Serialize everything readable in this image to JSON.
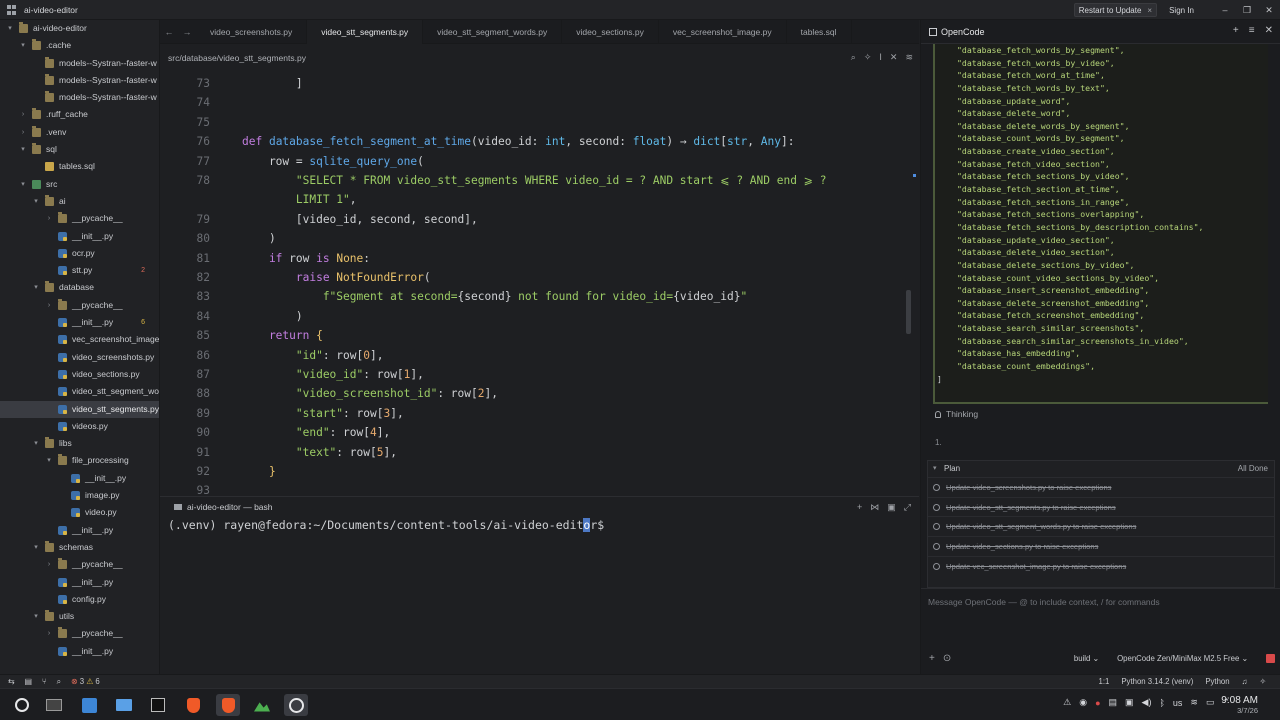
{
  "window": {
    "title": "ai-video-editor",
    "restart_label": "Restart to Update",
    "signin_label": "Sign In"
  },
  "sidebar": {
    "items": [
      {
        "label": "ai-video-editor",
        "depth": 0,
        "kind": "folder-open",
        "arrow": "▾"
      },
      {
        "label": ".cache",
        "depth": 1,
        "kind": "folder",
        "arrow": "▾"
      },
      {
        "label": "models--Systran--faster-w",
        "depth": 2,
        "kind": "folder",
        "arrow": ""
      },
      {
        "label": "models--Systran--faster-w",
        "depth": 2,
        "kind": "folder",
        "arrow": ""
      },
      {
        "label": "models--Systran--faster-w",
        "depth": 2,
        "kind": "folder",
        "arrow": ""
      },
      {
        "label": ".ruff_cache",
        "depth": 1,
        "kind": "folder",
        "arrow": "›"
      },
      {
        "label": ".venv",
        "depth": 1,
        "kind": "folder",
        "arrow": "›"
      },
      {
        "label": "sql",
        "depth": 1,
        "kind": "folder",
        "arrow": "▾"
      },
      {
        "label": "tables.sql",
        "depth": 2,
        "kind": "sql",
        "arrow": ""
      },
      {
        "label": "src",
        "depth": 1,
        "kind": "src",
        "arrow": "▾"
      },
      {
        "label": "ai",
        "depth": 2,
        "kind": "folder",
        "arrow": "▾"
      },
      {
        "label": "__pycache__",
        "depth": 3,
        "kind": "folder",
        "arrow": "›"
      },
      {
        "label": "__init__.py",
        "depth": 3,
        "kind": "py",
        "arrow": ""
      },
      {
        "label": "ocr.py",
        "depth": 3,
        "kind": "py",
        "arrow": ""
      },
      {
        "label": "stt.py",
        "depth": 3,
        "kind": "py",
        "arrow": "",
        "count": "2",
        "count_color": "red"
      },
      {
        "label": "database",
        "depth": 2,
        "kind": "folder",
        "arrow": "▾"
      },
      {
        "label": "__pycache__",
        "depth": 3,
        "kind": "folder",
        "arrow": "›"
      },
      {
        "label": "__init__.py",
        "depth": 3,
        "kind": "py",
        "arrow": "",
        "count": "6",
        "count_color": "yellow"
      },
      {
        "label": "vec_screenshot_image.",
        "depth": 3,
        "kind": "py",
        "arrow": ""
      },
      {
        "label": "video_screenshots.py",
        "depth": 3,
        "kind": "py",
        "arrow": ""
      },
      {
        "label": "video_sections.py",
        "depth": 3,
        "kind": "py",
        "arrow": ""
      },
      {
        "label": "video_stt_segment_wor",
        "depth": 3,
        "kind": "py",
        "arrow": ""
      },
      {
        "label": "video_stt_segments.py",
        "depth": 3,
        "kind": "py",
        "arrow": "",
        "selected": true
      },
      {
        "label": "videos.py",
        "depth": 3,
        "kind": "py",
        "arrow": ""
      },
      {
        "label": "libs",
        "depth": 2,
        "kind": "folder",
        "arrow": "▾"
      },
      {
        "label": "file_processing",
        "depth": 3,
        "kind": "folder",
        "arrow": "▾"
      },
      {
        "label": "__init__.py",
        "depth": 4,
        "kind": "py",
        "arrow": ""
      },
      {
        "label": "image.py",
        "depth": 4,
        "kind": "py",
        "arrow": ""
      },
      {
        "label": "video.py",
        "depth": 4,
        "kind": "py",
        "arrow": ""
      },
      {
        "label": "__init__.py",
        "depth": 3,
        "kind": "py",
        "arrow": ""
      },
      {
        "label": "schemas",
        "depth": 2,
        "kind": "folder",
        "arrow": "▾"
      },
      {
        "label": "__pycache__",
        "depth": 3,
        "kind": "folder",
        "arrow": "›"
      },
      {
        "label": "__init__.py",
        "depth": 3,
        "kind": "py",
        "arrow": ""
      },
      {
        "label": "config.py",
        "depth": 3,
        "kind": "py",
        "arrow": ""
      },
      {
        "label": "utils",
        "depth": 2,
        "kind": "folder",
        "arrow": "▾"
      },
      {
        "label": "__pycache__",
        "depth": 3,
        "kind": "folder",
        "arrow": "›"
      },
      {
        "label": "__init__.py",
        "depth": 3,
        "kind": "py",
        "arrow": ""
      }
    ]
  },
  "tabs": [
    {
      "label": "video_screenshots.py",
      "active": false
    },
    {
      "label": "video_stt_segments.py",
      "active": true
    },
    {
      "label": "video_stt_segment_words.py",
      "active": false
    },
    {
      "label": "video_sections.py",
      "active": false
    },
    {
      "label": "vec_screenshot_image.py",
      "active": false
    },
    {
      "label": "tables.sql",
      "active": false
    }
  ],
  "editor": {
    "path": "src/database/video_stt_segments.py",
    "lines": [
      {
        "n": "73",
        "tokens": [
          [
            "v",
            "        ]"
          ]
        ]
      },
      {
        "n": "74",
        "tokens": []
      },
      {
        "n": "75",
        "tokens": []
      },
      {
        "n": "76",
        "tokens": [
          [
            "k",
            "def "
          ],
          [
            "f",
            "database_fetch_segment_at_time"
          ],
          [
            "v",
            "(video_id: "
          ],
          [
            "ty",
            "int"
          ],
          [
            "v",
            ", second: "
          ],
          [
            "ty",
            "float"
          ],
          [
            "v",
            ") → "
          ],
          [
            "ty",
            "dict"
          ],
          [
            "v",
            "["
          ],
          [
            "ty",
            "str"
          ],
          [
            "v",
            ", "
          ],
          [
            "ty",
            "Any"
          ],
          [
            "v",
            "]:"
          ]
        ]
      },
      {
        "n": "77",
        "tokens": [
          [
            "v",
            "    row = "
          ],
          [
            "f",
            "sqlite_query_one"
          ],
          [
            "v",
            "("
          ]
        ]
      },
      {
        "n": "78",
        "tokens": [
          [
            "s",
            "        \"SELECT * FROM video_stt_segments WHERE video_id = ? AND start ⩽ ? AND end ⩾ ?"
          ]
        ]
      },
      {
        "n": "",
        "tokens": [
          [
            "s",
            "        LIMIT 1\""
          ],
          [
            "v",
            ","
          ]
        ]
      },
      {
        "n": "79",
        "tokens": [
          [
            "v",
            "        [video_id, second, second],"
          ]
        ]
      },
      {
        "n": "80",
        "tokens": [
          [
            "v",
            "    )"
          ]
        ]
      },
      {
        "n": "81",
        "tokens": [
          [
            "k",
            "    if "
          ],
          [
            "v",
            "row "
          ],
          [
            "k",
            "is "
          ],
          [
            "o",
            "None"
          ],
          [
            "v",
            ":"
          ]
        ]
      },
      {
        "n": "82",
        "tokens": [
          [
            "k",
            "        raise "
          ],
          [
            "o",
            "NotFoundError"
          ],
          [
            "v",
            "("
          ]
        ]
      },
      {
        "n": "83",
        "tokens": [
          [
            "s",
            "            f\"Segment at second="
          ],
          [
            "v",
            "{second}"
          ],
          [
            "s",
            " not found for video_id="
          ],
          [
            "v",
            "{video_id}"
          ],
          [
            "s",
            "\""
          ]
        ]
      },
      {
        "n": "84",
        "tokens": [
          [
            "v",
            "        )"
          ]
        ]
      },
      {
        "n": "85",
        "tokens": [
          [
            "k",
            "    return "
          ],
          [
            "o",
            "{"
          ]
        ]
      },
      {
        "n": "86",
        "tokens": [
          [
            "s",
            "        \"id\""
          ],
          [
            "v",
            ": row["
          ],
          [
            "n",
            "0"
          ],
          [
            "v",
            "],"
          ]
        ]
      },
      {
        "n": "87",
        "tokens": [
          [
            "s",
            "        \"video_id\""
          ],
          [
            "v",
            ": row["
          ],
          [
            "n",
            "1"
          ],
          [
            "v",
            "],"
          ]
        ]
      },
      {
        "n": "88",
        "tokens": [
          [
            "s",
            "        \"video_screenshot_id\""
          ],
          [
            "v",
            ": row["
          ],
          [
            "n",
            "2"
          ],
          [
            "v",
            "],"
          ]
        ]
      },
      {
        "n": "89",
        "tokens": [
          [
            "s",
            "        \"start\""
          ],
          [
            "v",
            ": row["
          ],
          [
            "n",
            "3"
          ],
          [
            "v",
            "],"
          ]
        ]
      },
      {
        "n": "90",
        "tokens": [
          [
            "s",
            "        \"end\""
          ],
          [
            "v",
            ": row["
          ],
          [
            "n",
            "4"
          ],
          [
            "v",
            "],"
          ]
        ]
      },
      {
        "n": "91",
        "tokens": [
          [
            "s",
            "        \"text\""
          ],
          [
            "v",
            ": row["
          ],
          [
            "n",
            "5"
          ],
          [
            "v",
            "],"
          ]
        ]
      },
      {
        "n": "92",
        "tokens": [
          [
            "o",
            "    }"
          ]
        ]
      },
      {
        "n": "93",
        "tokens": []
      }
    ]
  },
  "terminal": {
    "title": "ai-video-editor — bash",
    "prompt_before": "(.venv) rayen@fedora:~/Documents/content-tools/ai-video-edit",
    "prompt_cursor": "o",
    "prompt_after": "r$"
  },
  "opencode": {
    "title": "OpenCode",
    "json_lines": [
      "\"database_fetch_words_by_segment\",",
      "\"database_fetch_words_by_video\",",
      "\"database_fetch_word_at_time\",",
      "\"database_fetch_words_by_text\",",
      "\"database_update_word\",",
      "\"database_delete_word\",",
      "\"database_delete_words_by_segment\",",
      "\"database_count_words_by_segment\",",
      "\"database_create_video_section\",",
      "\"database_fetch_video_section\",",
      "\"database_fetch_sections_by_video\",",
      "\"database_fetch_section_at_time\",",
      "\"database_fetch_sections_in_range\",",
      "\"database_fetch_sections_overlapping\",",
      "\"database_fetch_sections_by_description_contains\",",
      "\"database_update_video_section\",",
      "\"database_delete_video_section\",",
      "\"database_delete_sections_by_video\",",
      "\"database_count_video_sections_by_video\",",
      "\"database_insert_screenshot_embedding\",",
      "\"database_delete_screenshot_embedding\",",
      "\"database_fetch_screenshot_embedding\",",
      "\"database_search_similar_screenshots\",",
      "\"database_search_similar_screenshots_in_video\",",
      "\"database_has_embedding\",",
      "\"database_count_embeddings\","
    ],
    "json_end": "]",
    "thinking_label": "Thinking",
    "dot_label": "1.",
    "plan_label": "Plan",
    "plan_status": "All Done",
    "plan_items": [
      "Update video_screenshots.py to raise exceptions",
      "Update video_stt_segments.py to raise exceptions",
      "Update video_stt_segment_words.py to raise exceptions",
      "Update video_sections.py to raise exceptions",
      "Update vec_screenshot_image.py to raise exceptions"
    ],
    "message_placeholder": "Message OpenCode — @ to include context, / for commands",
    "mode": "build",
    "model": "OpenCode Zen/MiniMax M2.5 Free"
  },
  "statusbar": {
    "errors": "3",
    "warnings": "6",
    "cursor_pos": "1:1",
    "interpreter": "Python 3.14.2 (venv)",
    "language": "Python"
  },
  "clock": {
    "time": "9:08 AM",
    "date": "3/7/26"
  },
  "tray": {
    "keyboard_layout": "us"
  },
  "colors": {
    "accent": "#4d78c4",
    "error": "#e06c5a",
    "warning": "#d8b545",
    "string": "#9ccc65"
  }
}
